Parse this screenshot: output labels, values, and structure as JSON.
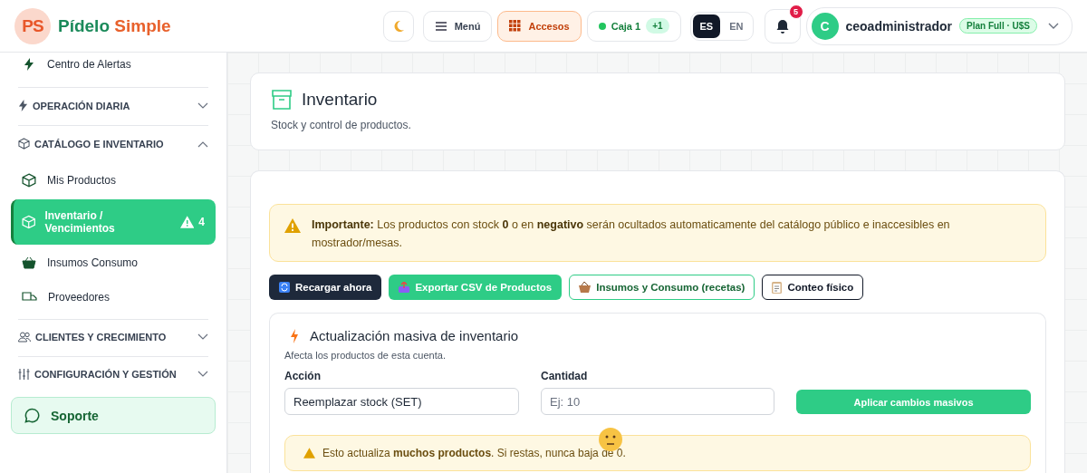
{
  "brand": {
    "logo_text": "PS",
    "name_first": "Pídelo",
    "name_second": "Simple"
  },
  "topbar": {
    "menu": {
      "label": "Menú",
      "selected": false
    },
    "accesos": {
      "label": "Accesos",
      "selected": true
    },
    "register": {
      "label": "Caja 1",
      "badge": "+1",
      "color": "#22c55e"
    },
    "languages": [
      {
        "label": "ES",
        "selected": true
      },
      {
        "label": "EN",
        "selected": false
      }
    ],
    "notifications": {
      "count": "5"
    },
    "user": {
      "initial": "C",
      "name": "ceoadministrador",
      "plan": "Plan Full · U$S"
    }
  },
  "sidebar": {
    "items": [
      {
        "kind": "link",
        "label": "Centro de Alertas",
        "selected": false
      },
      {
        "kind": "section",
        "label": "OPERACIÓN DIARIA",
        "expanded": false
      },
      {
        "kind": "section",
        "label": "CATÁLOGO E INVENTARIO",
        "expanded": true,
        "children": [
          {
            "label": "Mis Productos",
            "selected": false
          },
          {
            "label": "Inventario / Vencimientos",
            "selected": true,
            "alert_count": "4"
          },
          {
            "label": "Insumos Consumo",
            "selected": false
          },
          {
            "label": "Proveedores",
            "selected": false
          }
        ]
      },
      {
        "kind": "section",
        "label": "CLIENTES Y CRECIMIENTO",
        "expanded": false
      },
      {
        "kind": "section",
        "label": "CONFIGURACIÓN Y GESTIÓN",
        "expanded": false
      },
      {
        "kind": "support",
        "label": "Soporte"
      }
    ]
  },
  "page_header": {
    "title": "Inventario",
    "subtitle": "Stock y control de productos."
  },
  "notice": {
    "text": "**Importante:** Los productos con stock **0** o en **negativo** serán ocultados automaticamente del catálogo público e inaccesibles en mostrador/mesas."
  },
  "actions": [
    {
      "kind": "dark",
      "label": "Recargar ahora"
    },
    {
      "kind": "green",
      "label": "Exportar CSV de Productos"
    },
    {
      "kind": "outline-green",
      "label": "Insumos y Consumo (recetas)"
    },
    {
      "kind": "outline-dark",
      "label": "Conteo físico"
    }
  ],
  "bulk_update": {
    "title": "Actualización masiva de inventario",
    "subtitle": "Afecta los productos de esta cuenta.",
    "action_field": {
      "label": "Acción",
      "value": "Reemplazar stock (SET)"
    },
    "quantity_field": {
      "label": "Cantidad",
      "placeholder": "Ej: 10"
    },
    "apply_button": "Aplicar cambios masivos",
    "warning": "Esto actualiza **muchos productos**. Si restas, nunca baja de 0."
  }
}
